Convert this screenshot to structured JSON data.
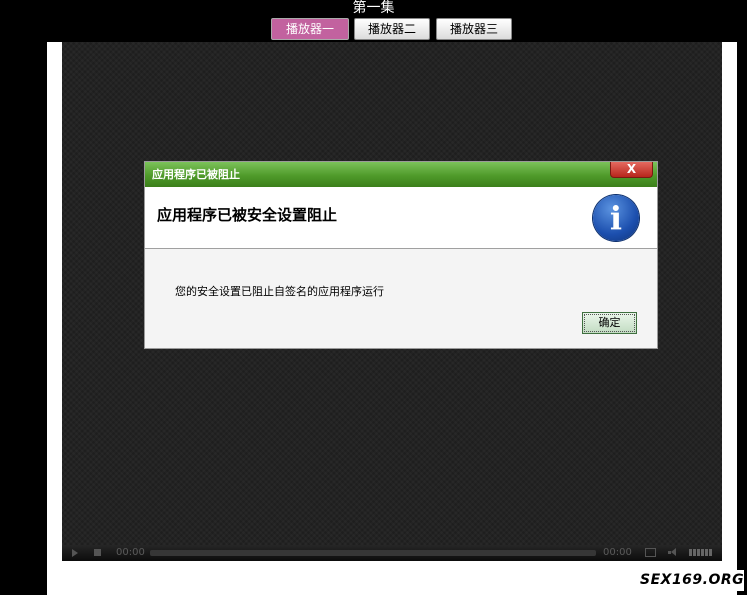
{
  "page": {
    "episode_title": "第一集",
    "tabs": [
      {
        "label": "播放器一",
        "active": true
      },
      {
        "label": "播放器二",
        "active": false
      },
      {
        "label": "播放器三",
        "active": false
      }
    ],
    "colors": {
      "active_tab": "#c2629f",
      "titlebar_green": "#4f9a2a",
      "close_red": "#c0392b"
    }
  },
  "player": {
    "current_time": "00:00",
    "duration": "00:00",
    "progress_fraction": 0,
    "icons": [
      "play-icon",
      "stop-icon",
      "fullscreen-icon",
      "volume-icon"
    ]
  },
  "dialog": {
    "window_title": "应用程序已被阻止",
    "close_label": "X",
    "heading": "应用程序已被安全设置阻止",
    "icon": "info-icon",
    "icon_glyph": "i",
    "message": "您的安全设置已阻止自签名的应用程序运行",
    "ok_label": "确定"
  },
  "watermark": {
    "text": "SEX169.ORG"
  }
}
